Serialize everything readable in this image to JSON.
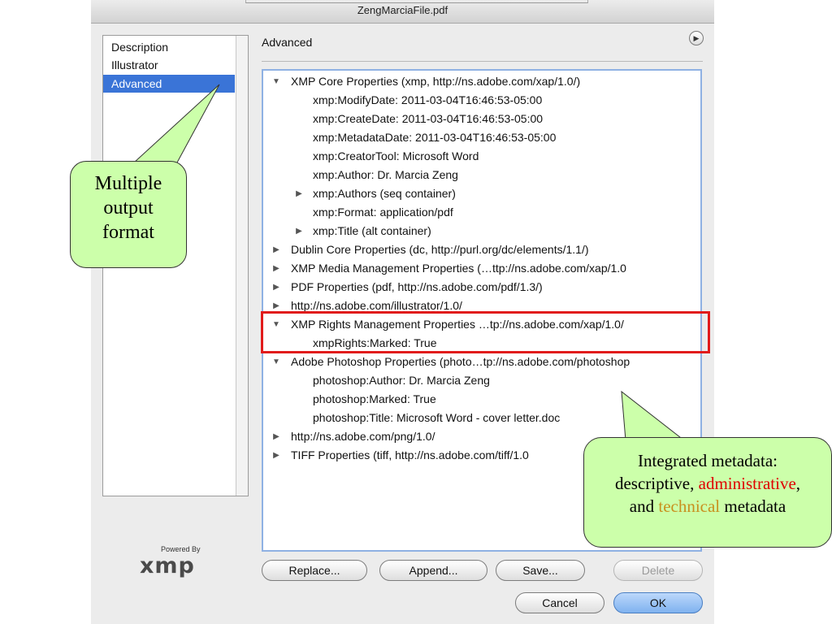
{
  "window": {
    "title": "ZengMarciaFile.pdf"
  },
  "sidebar": {
    "items": [
      {
        "label": "Description",
        "selected": false
      },
      {
        "label": "Illustrator",
        "selected": false
      },
      {
        "label": "Advanced",
        "selected": true
      }
    ]
  },
  "panel": {
    "title": "Advanced"
  },
  "tree": {
    "rows": [
      {
        "text": "XMP Core Properties (xmp, http://ns.adobe.com/xap/1.0/)",
        "level": 0,
        "disclosure": "expanded"
      },
      {
        "text": "xmp:ModifyDate: 2011-03-04T16:46:53-05:00",
        "level": 1,
        "disclosure": "none"
      },
      {
        "text": "xmp:CreateDate: 2011-03-04T16:46:53-05:00",
        "level": 1,
        "disclosure": "none"
      },
      {
        "text": "xmp:MetadataDate: 2011-03-04T16:46:53-05:00",
        "level": 1,
        "disclosure": "none"
      },
      {
        "text": "xmp:CreatorTool: Microsoft Word",
        "level": 1,
        "disclosure": "none"
      },
      {
        "text": "xmp:Author: Dr. Marcia Zeng",
        "level": 1,
        "disclosure": "none"
      },
      {
        "text": "xmp:Authors (seq container)",
        "level": 1,
        "disclosure": "collapsed"
      },
      {
        "text": "xmp:Format: application/pdf",
        "level": 1,
        "disclosure": "none"
      },
      {
        "text": "xmp:Title (alt container)",
        "level": 1,
        "disclosure": "collapsed"
      },
      {
        "text": "Dublin Core Properties (dc, http://purl.org/dc/elements/1.1/)",
        "level": 0,
        "disclosure": "collapsed"
      },
      {
        "text": "XMP Media Management Properties (…ttp://ns.adobe.com/xap/1.0",
        "level": 0,
        "disclosure": "collapsed"
      },
      {
        "text": "PDF Properties (pdf, http://ns.adobe.com/pdf/1.3/)",
        "level": 0,
        "disclosure": "collapsed"
      },
      {
        "text": "http://ns.adobe.com/illustrator/1.0/",
        "level": 0,
        "disclosure": "collapsed"
      },
      {
        "text": "XMP Rights Management Properties …tp://ns.adobe.com/xap/1.0/",
        "level": 0,
        "disclosure": "expanded"
      },
      {
        "text": "xmpRights:Marked: True",
        "level": 1,
        "disclosure": "none"
      },
      {
        "text": "Adobe Photoshop Properties (photo…tp://ns.adobe.com/photoshop",
        "level": 0,
        "disclosure": "expanded"
      },
      {
        "text": "photoshop:Author: Dr. Marcia Zeng",
        "level": 1,
        "disclosure": "none"
      },
      {
        "text": "photoshop:Marked: True",
        "level": 1,
        "disclosure": "none"
      },
      {
        "text": "photoshop:Title: Microsoft Word - cover letter.doc",
        "level": 1,
        "disclosure": "none"
      },
      {
        "text": "http://ns.adobe.com/png/1.0/",
        "level": 0,
        "disclosure": "collapsed"
      },
      {
        "text": "TIFF Properties (tiff, http://ns.adobe.com/tiff/1.0",
        "level": 0,
        "disclosure": "collapsed"
      }
    ]
  },
  "logo": {
    "powered_by": "Powered By",
    "brand": "xmp"
  },
  "buttons": {
    "replace": "Replace...",
    "append": "Append...",
    "save": "Save...",
    "delete": "Delete",
    "cancel": "Cancel",
    "ok": "OK"
  },
  "callouts": {
    "left": {
      "line1": "Multiple",
      "line2": "output",
      "line3": "format"
    },
    "right": {
      "line1": "Integrated metadata:",
      "descriptive": "descriptive,",
      "administrative": "administrative",
      "and": "and",
      "technical": "technical",
      "metadata": "metadata",
      "comma": ","
    }
  },
  "colors": {
    "selection": "#3a74d7",
    "callout_fill": "#ccffaa",
    "highlight_box": "#e11b1b",
    "administrative_text": "#e00000",
    "technical_text": "#c8901e"
  }
}
